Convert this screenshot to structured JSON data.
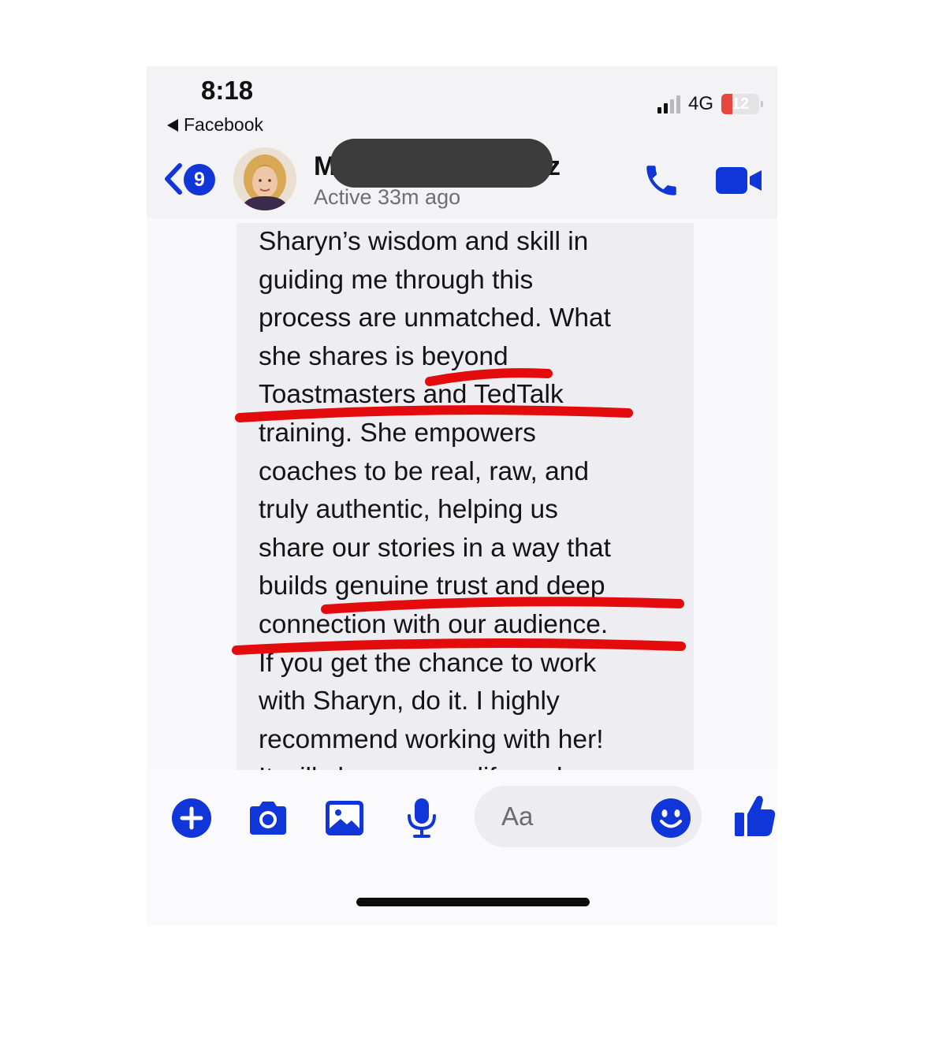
{
  "status_bar": {
    "time": "8:18",
    "back_app": "Facebook",
    "network": "4G",
    "battery": "12",
    "battery_level": 0.12,
    "signal_bars": 2
  },
  "header": {
    "unread_count": "9",
    "contact_name_start": "M",
    "contact_name_end": "z",
    "active_status": "Active 33m ago"
  },
  "message": {
    "text": "Sharyn’s wisdom and skill in\nguiding me through this\nprocess are unmatched. What\nshe shares is beyond\nToastmasters and TedTalk\ntraining. She empowers\ncoaches to be real, raw, and\ntruly authentic, helping us\nshare our stories in a way that\nbuilds genuine trust and deep\nconnection with our audience.\nIf you get the chance to work\nwith Sharyn, do it. I highly\nrecommend working with her!\nIt will change your life and"
  },
  "composer": {
    "placeholder": "Aa"
  },
  "icons": [
    "back-chevron-icon",
    "phone-icon",
    "video-camera-icon",
    "plus-icon",
    "camera-icon",
    "image-icon",
    "microphone-icon",
    "emoji-icon",
    "thumbs-up-icon"
  ],
  "colors": {
    "accent": "#1036d9",
    "annotation": "#e30b0b",
    "battery_low": "#e8453c"
  }
}
